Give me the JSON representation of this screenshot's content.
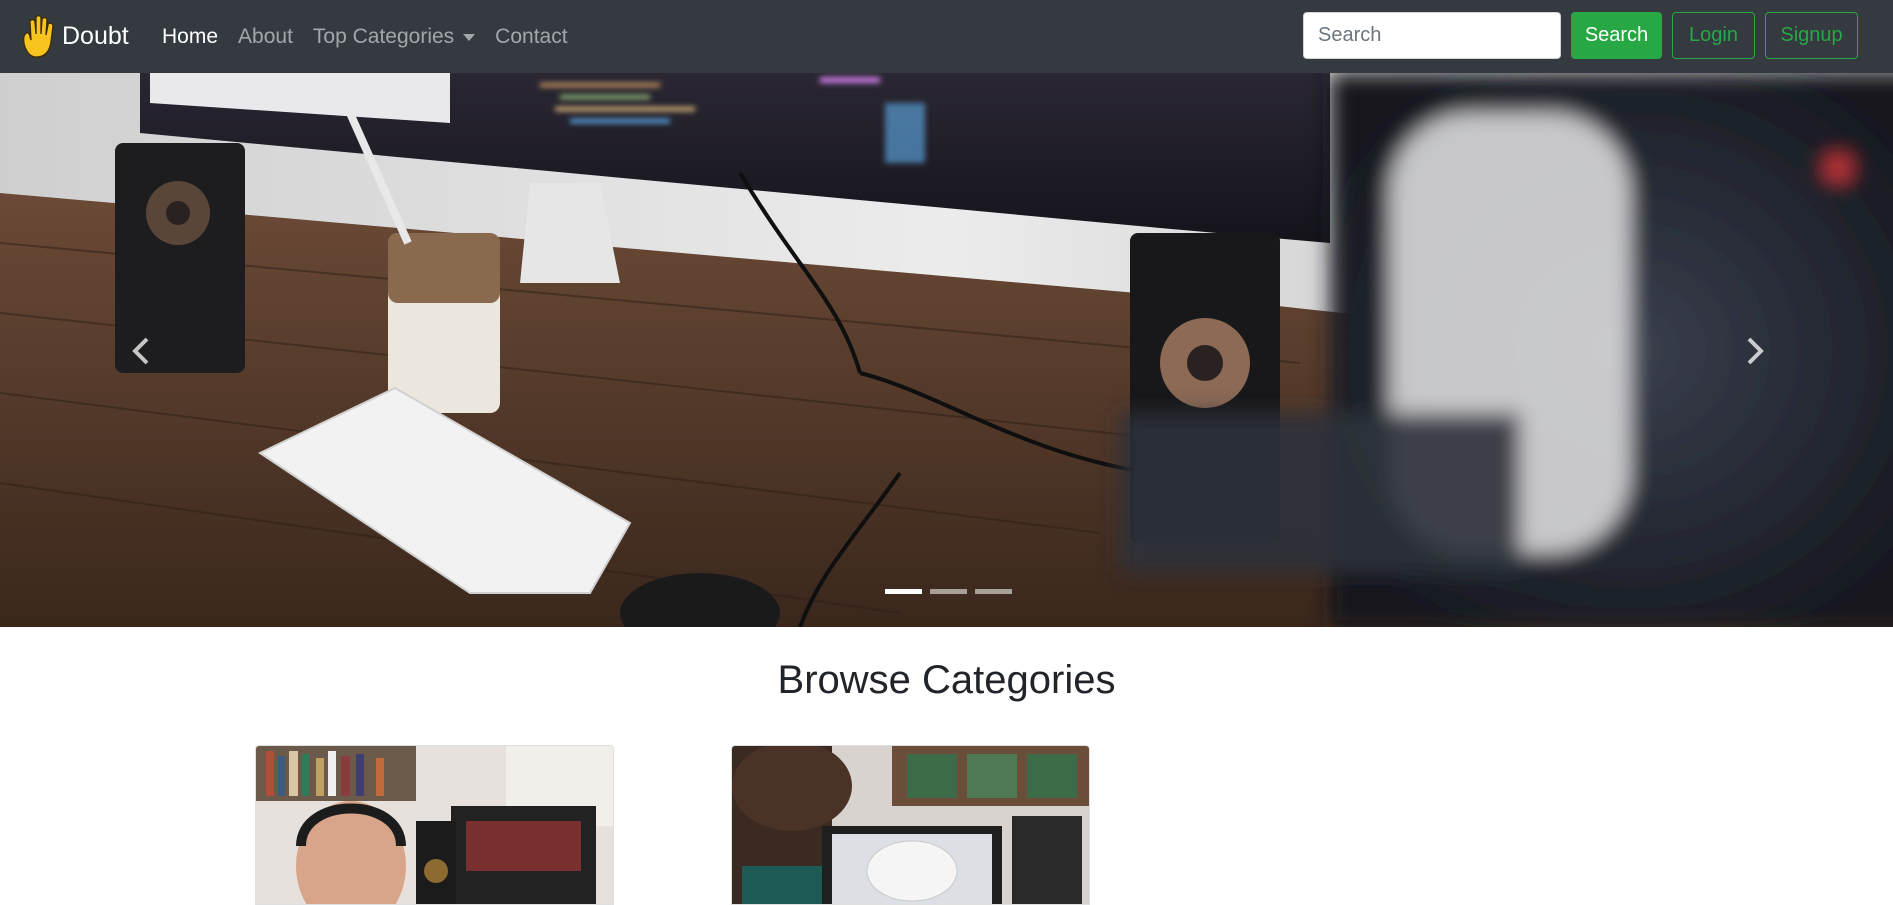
{
  "navbar": {
    "brand": "Doubt",
    "brand_icon": "raised-hand-icon",
    "links": [
      "Home",
      "About",
      "Top Categories",
      "Contact"
    ],
    "active_link": "Home",
    "search_placeholder": "Search",
    "search_button": "Search",
    "login_button": "Login",
    "signup_button": "Signup"
  },
  "carousel": {
    "prev_icon": "chevron-left-icon",
    "next_icon": "chevron-right-icon",
    "slide_count": 3,
    "active_slide": 1
  },
  "browse": {
    "title": "Browse Categories"
  },
  "colors": {
    "navbar_bg": "#343a40",
    "success": "#28a745",
    "text_dark": "#212529"
  }
}
